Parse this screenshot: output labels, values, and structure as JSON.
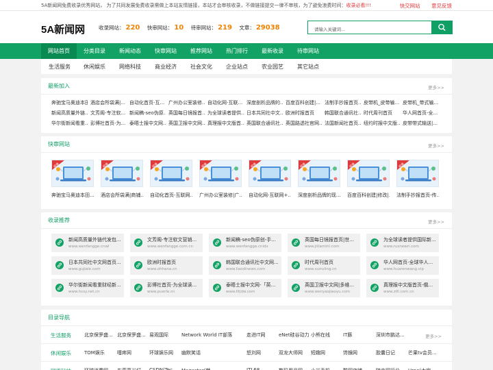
{
  "topbar": {
    "notice": "5A新闻网免费收录优秀网站， 为了共同发展免费收录需做上本站友情链接，本站才会审核收录，不做链接提交一律不审核，为了避免浪费时间：",
    "notice_red": "收录必看!!!",
    "links": [
      "快交网站",
      "意见反馈"
    ]
  },
  "header": {
    "logo": "5A新闻网",
    "stats": [
      {
        "label": "收录网站：",
        "value": "220"
      },
      {
        "label": "快审网站：",
        "value": "10"
      },
      {
        "label": "待审网站：",
        "value": "219"
      },
      {
        "label": "文章：",
        "value": "29038"
      }
    ],
    "search_placeholder": "请输入关键词...",
    "search_icon": "search-icon"
  },
  "nav": [
    "网站首页",
    "分类目录",
    "新闻动态",
    "快审网站",
    "推荐网站",
    "热门排行",
    "最新收录",
    "待审网站"
  ],
  "subnav": [
    "生活服务",
    "休闲娱乐",
    "网络科技",
    "商业经济",
    "社会文化",
    "企业站点",
    "农业园艺",
    "其它站点"
  ],
  "latest": {
    "title": "最新加入",
    "more": "更多>>",
    "rows": [
      [
        "奔驰宝马奥迪本田...",
        "酒店会所袋满|...",
        "自动化首页-互...",
        "广州办公室装修...",
        "自动化网-互联...",
        "深度剖析品牌的...",
        "百度百科创建|...",
        "法制手抄报首页...",
        "皮带机_皮带输...",
        "皮带机_带式输..."
      ],
      [
        "新闻高质量外链...",
        "文芳阁-专注软...",
        "新闻稿-seo伪原...",
        "英国每日镜报首...",
        "为全球读者提供...",
        "日本共同社中文...",
        "欧洲时报首页",
        "韩国联合通讯社...",
        "时代周刊首页",
        "华人网首页-全..."
      ],
      [
        "华尔街新闻看重...",
        "彭博社首页-为...",
        "泰晤士报中文网...",
        "英国卫报中文网...",
        "真理报中文版首...",
        "英国联合通讯社...",
        "英国路透社官网...",
        "法国新闻社首页...",
        "纽约时报中文版...",
        "皮带带式输送|..."
      ]
    ]
  },
  "fast": {
    "title": "快审网站",
    "more": "更多>>",
    "badge": "收录",
    "items": [
      "奔驰宝马奥迪本田...",
      "酒店会所袋满|商铺...",
      "自动化首页-互联网...",
      "广州办公室装修|广...",
      "自动化网-互联网+...",
      "深度剖析品牌的现...",
      "百度百科创建|修改|...",
      "法制手抄报首页-传..."
    ]
  },
  "recommend": {
    "title": "收录推荐",
    "more": "更多>>",
    "items": [
      {
        "name": "新闻高质量外链代发包...",
        "url": "www.wenfangge.cnwl"
      },
      {
        "name": "文芳阁-专注软文营销...",
        "url": "www.wenfangge.com.cn"
      },
      {
        "name": "新闻稿-seo伪原创-手...",
        "url": "www.wenfangge.cnidx"
      },
      {
        "name": "英国每日镜报首页|世...",
        "url": "www.jiitamirii.com"
      },
      {
        "name": "为全球读者提供国际新...",
        "url": "www.rusnewri.com"
      },
      {
        "name": "日本共同社中文网首页...",
        "url": "www.gujiale.com"
      },
      {
        "name": "欧洲时报首页",
        "url": "www.ohhana.cn"
      },
      {
        "name": "韩国联合通讯社中文网...",
        "url": "www.liaodinews.com"
      },
      {
        "name": "时代周刊首页",
        "url": "www.suiruling.cn"
      },
      {
        "name": "华人网首页-全球华人...",
        "url": "www.huarenwang.vip"
      },
      {
        "name": "华尔街新闻看重财经新...",
        "url": "www.hcsy.net.cn"
      },
      {
        "name": "彭博社首页-为全球读...",
        "url": "www.puerle.cn"
      },
      {
        "name": "泰晤士报中文网-「英...",
        "url": "www.lltjdw.com"
      },
      {
        "name": "英国卫报中文网|多维...",
        "url": "www.wenyaojiaoyu.com"
      },
      {
        "name": "真理报中文版首页-俄...",
        "url": "www.ztll.com.cn"
      }
    ]
  },
  "directory": {
    "title": "目录导航",
    "more": "更多>>",
    "rows": [
      {
        "cat": "生活服务",
        "sites": [
          "北京保罗盛...",
          "北京保罗盛...",
          "易观国际",
          "Network World IT部落",
          "走进IT网",
          "eNet硅谷动力",
          "小熊在线",
          "IT豚",
          "深圳市鹏达..."
        ]
      },
      {
        "cat": "休闲娱乐",
        "sites": [
          "TOM娱乐",
          "噻疼网",
          "环球娱乐网",
          "幽默笑话",
          "怒刘网",
          "双龙大师网",
          "短趣网",
          "馋猴网",
          "胶囊日记",
          "芒果tv会员..."
        ]
      },
      {
        "cat": "网络科技",
        "sites": [
          "环球消费网",
          "东莞亮光灯",
          "CSDN(Tec...",
          "Magastar(魅...",
          "ITL68",
          "数码用品网",
          "小米手机",
          "酷网店铺",
          "随身网行业...",
          "Uroe(大宇..."
        ]
      }
    ]
  }
}
